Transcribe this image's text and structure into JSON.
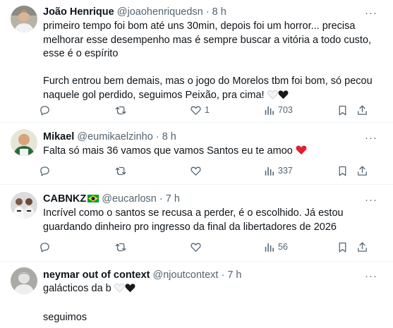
{
  "tweets": [
    {
      "name": "João Henrique",
      "handle": "@joaohenriquedsn",
      "sep": "·",
      "time": "8 h",
      "more": "···",
      "paragraphs": [
        "primeiro tempo foi bom até uns 30min, depois foi um horror... precisa melhorar esse desempenho mas é sempre buscar a vitória a todo custo, esse é o espírito",
        "Furch entrou bem demais, mas o jogo do Morelos tbm foi bom, só pecou naquele gol perdido, seguimos Peixão, pra cima!"
      ],
      "emoji": [
        "white-heart",
        "black-heart"
      ],
      "likes": "1",
      "views": "703"
    },
    {
      "name": "Mikael",
      "handle": "@eumikaelzinho",
      "sep": "·",
      "time": "8 h",
      "more": "···",
      "paragraphs": [
        "Falta só mais 36 vamos que vamos Santos eu te amoo"
      ],
      "emoji": [
        "red-heart"
      ],
      "views": "337"
    },
    {
      "name": "CABNKZ",
      "flag": "brazil-flag",
      "handle": "@eucarlosn",
      "sep": "·",
      "time": "7 h",
      "more": "···",
      "paragraphs": [
        "Incrível como o santos se recusa a perder, é o escolhido. Já estou guardando dinheiro pro ingresso da final da libertadores de 2026"
      ],
      "views": "56"
    },
    {
      "name": "neymar out of context",
      "handle": "@njoutcontext",
      "sep": "·",
      "time": "7 h",
      "more": "···",
      "paragraphs": [
        "galácticos da b",
        "seguimos"
      ],
      "emoji": [
        "white-heart",
        "black-heart"
      ]
    }
  ],
  "colors": {
    "text": "#0f1419",
    "secondary": "#536471",
    "divider": "#eff3f4",
    "red_heart": "#f91880",
    "brazil_green": "#009c3b",
    "brazil_yellow": "#ffdf00",
    "brazil_blue": "#002776"
  },
  "icons": [
    "reply-icon",
    "retweet-icon",
    "like-icon",
    "views-icon",
    "bookmark-icon",
    "share-icon",
    "more-icon"
  ]
}
